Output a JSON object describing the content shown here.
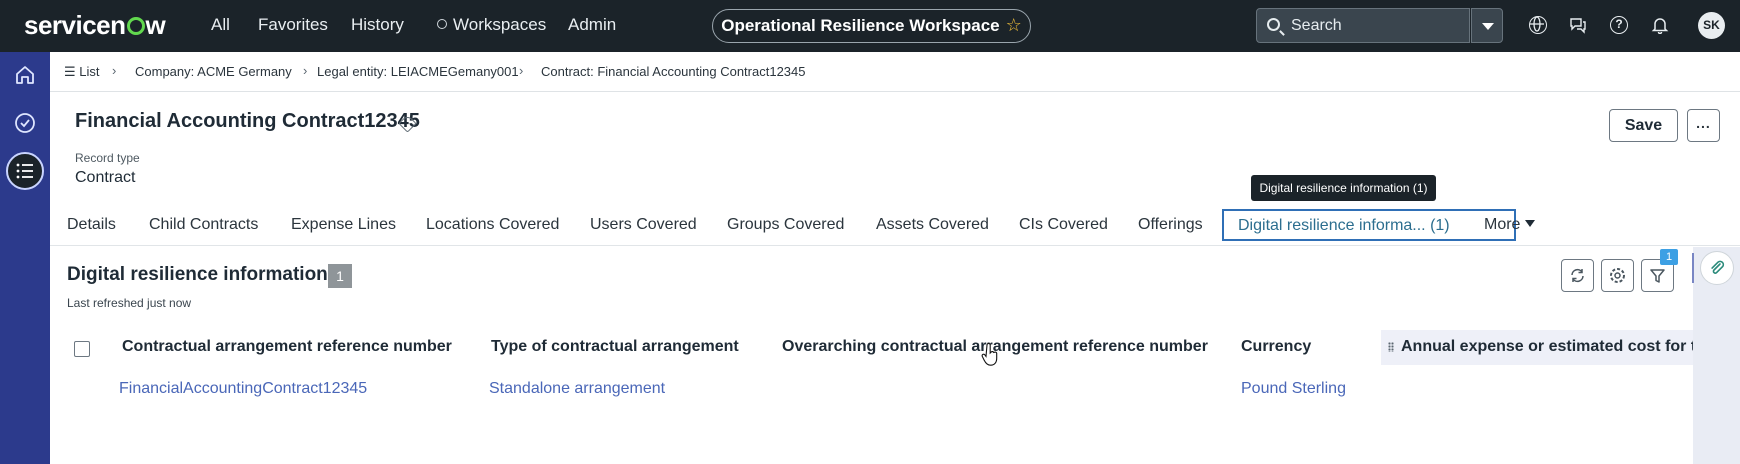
{
  "header": {
    "logo": "servicenow",
    "nav": [
      "All",
      "Favorites",
      "History",
      "Workspaces",
      "Admin"
    ],
    "workspace_title": "Operational Resilience Workspace",
    "search_label": "Search",
    "avatar_initials": "SK"
  },
  "breadcrumb": {
    "list_label": "List",
    "items": [
      "Company: ACME Germany",
      "Legal entity: LEIACMEGemany001",
      "Contract: Financial Accounting Contract12345"
    ]
  },
  "record": {
    "title": "Financial Accounting Contract12345",
    "record_type_label": "Record type",
    "record_type_value": "Contract",
    "save_label": "Save",
    "more_label": "..."
  },
  "tooltip": "Digital resilience information (1)",
  "tabs": {
    "items": [
      "Details",
      "Child Contracts",
      "Expense Lines",
      "Locations Covered",
      "Users Covered",
      "Groups Covered",
      "Assets Covered",
      "CIs Covered",
      "Offerings",
      "Digital resilience informa... (1)"
    ],
    "more_label": "More",
    "active_index": 9
  },
  "related_list": {
    "title": "Digital resilience information",
    "count": "1",
    "refreshed": "Last refreshed just now",
    "filter_badge": "1",
    "columns": [
      "Contractual arrangement reference number",
      "Type of contractual arrangement",
      "Overarching contractual arrangement reference number",
      "Currency",
      "Annual expense or estimated cost for the"
    ],
    "row": {
      "reference": "FinancialAccountingContract12345",
      "type": "Standalone arrangement",
      "overarching": "",
      "currency": "Pound Sterling"
    }
  },
  "colors": {
    "header_bg": "#1b2329",
    "rail_bg": "#2c3a8c",
    "link": "#4a67b8",
    "active_tab_border": "#2f6fb6",
    "logo_accent": "#62d84e"
  }
}
